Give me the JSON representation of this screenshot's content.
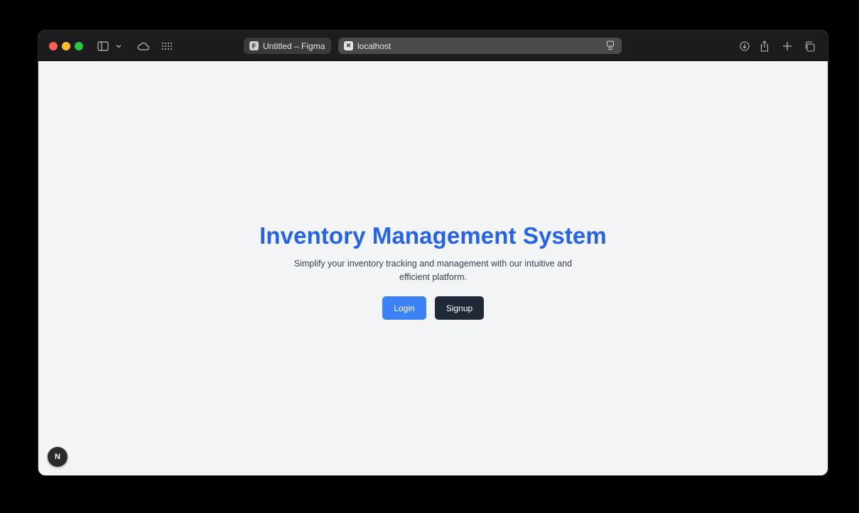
{
  "browser": {
    "tabs": [
      {
        "title": "Untitled – Figma",
        "favicon": "F"
      },
      {
        "title": "localhost",
        "favicon": "✕"
      }
    ],
    "icons": [
      "sidebar-icon",
      "chevron-down-icon",
      "cloud-icon",
      "grid-icon",
      "reader-icon",
      "download-icon",
      "share-icon",
      "plus-icon",
      "tabs-overview-icon"
    ]
  },
  "page": {
    "title": "Inventory Management System",
    "subtitle": "Simplify your inventory tracking and management with our intuitive and efficient platform.",
    "login_label": "Login",
    "signup_label": "Signup",
    "dev_badge": "N"
  },
  "colors": {
    "accent": "#2563eb",
    "login_button": "#3b82f6",
    "signup_button": "#1f2937",
    "background": "#f3f4f6"
  }
}
